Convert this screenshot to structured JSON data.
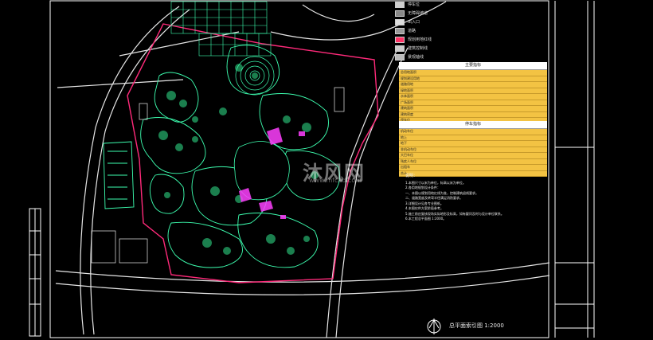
{
  "legend": {
    "items": [
      {
        "label": "停车位",
        "swatch": "#cfcfcf"
      },
      {
        "label": "无障碍坡道",
        "swatch": "#888888"
      },
      {
        "label": "出入口",
        "swatch": "#dddddd"
      },
      {
        "label": "道路",
        "swatch": "#999999"
      },
      {
        "label": "规划用地红线",
        "swatch": "#ff3366"
      },
      {
        "label": "建筑控制线",
        "swatch": "#cccccc"
      },
      {
        "label": "景观轴线",
        "swatch": "#bbbbbb"
      },
      {
        "label": "消防通道",
        "swatch": "#aaaaaa"
      }
    ]
  },
  "table_top": {
    "title": "主要指标",
    "rows": [
      [
        "总用地面积",
        "",
        "",
        ""
      ],
      [
        "  规划建设用地",
        "",
        "",
        ""
      ],
      [
        "  道路用地",
        "",
        "",
        ""
      ],
      [
        "  绿地面积",
        "",
        "",
        ""
      ],
      [
        "  水体面积",
        "",
        "",
        ""
      ],
      [
        "  广场面积",
        "",
        "",
        ""
      ],
      [
        "  建筑面积",
        "",
        "",
        ""
      ],
      [
        "  建筑密度",
        "",
        "",
        ""
      ],
      [
        "  停车位",
        "",
        "",
        ""
      ],
      [
        "绿地率",
        "",
        "",
        ""
      ]
    ]
  },
  "table_bottom": {
    "title": "停车指标",
    "rows": [
      [
        "机动车位",
        "",
        "",
        ""
      ],
      [
        "  地上",
        "",
        "",
        ""
      ],
      [
        "  地下",
        "",
        "",
        ""
      ],
      [
        "非机动车位",
        "",
        "",
        ""
      ],
      [
        "大巴车位",
        "",
        "",
        ""
      ],
      [
        "残疾人车位",
        "",
        "",
        ""
      ],
      [
        "出租车",
        "",
        "",
        ""
      ],
      [
        "合计",
        "",
        "",
        ""
      ]
    ]
  },
  "notes": {
    "title": "说明：",
    "lines": [
      "1.本图尺寸以米为单位，标高以米为单位。",
      "2.各用地规划设计条件：",
      "  一、本图以规划用地红线为准，控制建筑退线要求。",
      "  二、道路宽度及转弯半径满足消防要求。",
      "3.详细设计见各专业图纸。",
      "4.本图仅供方案阶段参考。",
      "5.施工前应复核现场实际地形及标高，如有疑问及时与设计单位联系。",
      "6.本工程总平面图 1:2000。"
    ]
  },
  "caption": "总平面索引图  1:2000",
  "watermark": {
    "main": "沐风网",
    "sub": "www.mfcad.com"
  },
  "colors": {
    "background": "#000000",
    "road": "#e6e6e6",
    "site_boundary": "#ff2a7a",
    "landscape": "#3dffb0",
    "tree_canopy": "#32e88f",
    "accent_magenta": "#ff40ff",
    "table_fill": "#f3c343",
    "frame": "#ffffff"
  }
}
